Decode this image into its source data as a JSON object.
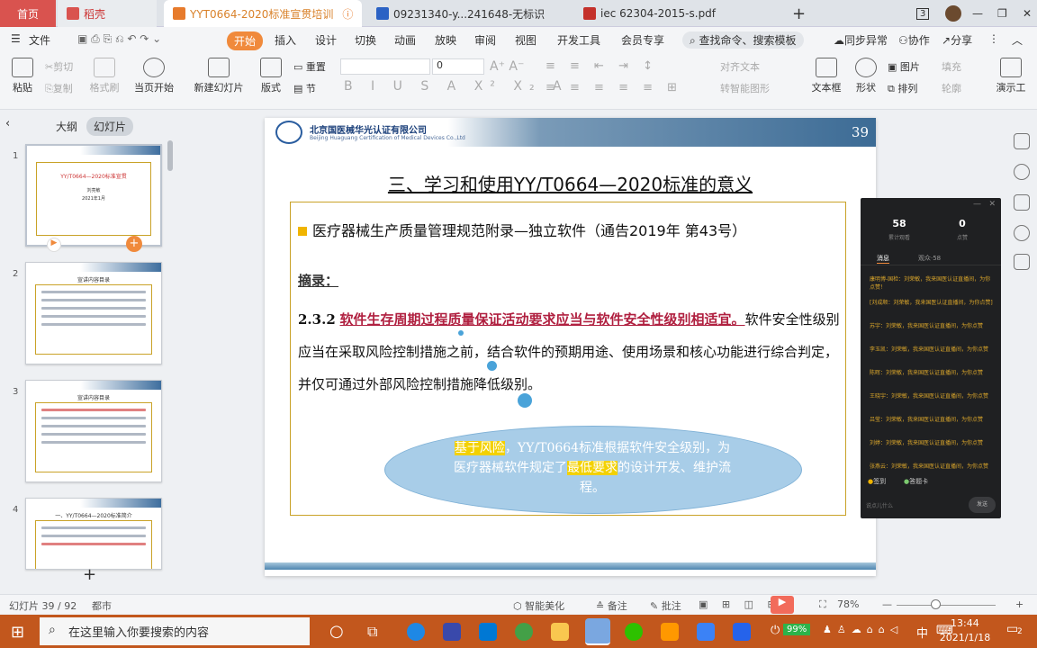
{
  "tabs": {
    "home": "首页",
    "docer": "稻壳",
    "t1": "YYT0664-2020标准宣贯培训",
    "t2": "09231340-y...241648-无标识",
    "t3": "iec 62304-2015-s.pdf",
    "add": "+",
    "badge": "3"
  },
  "menu": {
    "file": "文件",
    "start": "开始",
    "insert": "插入",
    "design": "设计",
    "switch": "切换",
    "anim": "动画",
    "show": "放映",
    "review": "审阅",
    "view": "视图",
    "dev": "开发工具",
    "member": "会员专享",
    "search": "查找命令、搜索模板",
    "sync": "同步异常",
    "collab": "协作",
    "share": "分享"
  },
  "ribbon": {
    "paste": "粘贴",
    "cut": "剪切",
    "copy": "复制",
    "format": "格式刷",
    "from_current": "当页开始",
    "new_slide": "新建幻灯片",
    "layout": "版式",
    "section": "节",
    "reset": "重置",
    "font_size": "0",
    "text_box": "文本框",
    "shape": "形状",
    "arrange": "排列",
    "picture": "图片",
    "fill": "填充",
    "outline": "轮廓",
    "align_text": "对齐文本",
    "convert_smart": "转智能图形",
    "present": "演示工"
  },
  "panel": {
    "outline": "大纲",
    "slides": "幻灯片",
    "add": "+",
    "thumbs": [
      {
        "num": "1",
        "title": "YY/T0664—2020标准宣贯",
        "sub": "刘亮敏",
        "date": "2021年1月"
      },
      {
        "num": "2",
        "title": "宣讲内容目录"
      },
      {
        "num": "3",
        "title": "宣讲内容目录"
      },
      {
        "num": "4",
        "title": "一、YY/T0664—2020标准简介"
      }
    ]
  },
  "slide": {
    "page_number": "39",
    "company_cn": "北京国医械华光认证有限公司",
    "company_en": "Beijing Huaguang Certification of Medical Devices Co.,Ltd",
    "title": "三、学习和使用YY/T0664—2020标准的意义",
    "bullet": "医疗器械生产质量管理规范附录—独立软件（通告2019年 第43号）",
    "abstract": "摘录：",
    "clause": "2.3.2",
    "red_text": "软件生存周期过程质量保证活动要求应当与软件安全性级别相适宜。",
    "body": "软件安全性级别应当在采取风险控制措施之前，结合软件的预期用途、使用场景和核心功能进行综合判定，并仅可通过外部风险控制措施降低级别。",
    "cloud": {
      "hl1": "基于风险",
      "t1": "，YY/T0664标准根据软件安全级别，为医疗器械软件规定了",
      "hl2": "最低要求",
      "t2": "的设计开发、维护流程。"
    }
  },
  "chat": {
    "count1": "58",
    "label1": "累计观看",
    "count2": "0",
    "label2": "点赞",
    "tab1": "消息",
    "tab2": "观众·58",
    "messages": [
      "康明博-国检：刘荣敏，我来国医认证直播间，为你点赞！",
      "[刘成顺：刘荣敏，我来国医认证直播间，为你点赞]",
      "苏宇：刘荣敏，我来国医认证直播间，为你点赞",
      "李玉凯：刘荣敏，我来国医认证直播间，为你点赞",
      "陈晖：刘荣敏，我来国医认证直播间，为你点赞",
      "王晓宇：刘荣敏，我来国医认证直播间，为你点赞",
      "吕莹：刘荣敏，我来国医认证直播间，为你点赞",
      "刘婷：刘荣敏，我来国医认证直播间，为你点赞",
      "张燕云：刘荣敏，我来国医认证直播间，为你点赞"
    ],
    "gift": "签到",
    "card": "答题卡",
    "input": "说点儿什么",
    "send": "发送"
  },
  "status": {
    "slide_count": "幻灯片 39 / 92",
    "theme": "都市",
    "beautify": "智能美化",
    "notes": "备注",
    "comments": "批注",
    "zoom": "78%"
  },
  "taskbar": {
    "search": "在这里输入你要搜索的内容",
    "battery": "99%",
    "ime": "中",
    "time": "13:44",
    "date": "2021/1/18",
    "notif": "2"
  },
  "colors": {
    "accent": "#f08a3c",
    "taskbar": "#c2571d",
    "slide_red": "#b02040",
    "box_gold": "#c9a227",
    "cloud": "#a8cde8"
  }
}
